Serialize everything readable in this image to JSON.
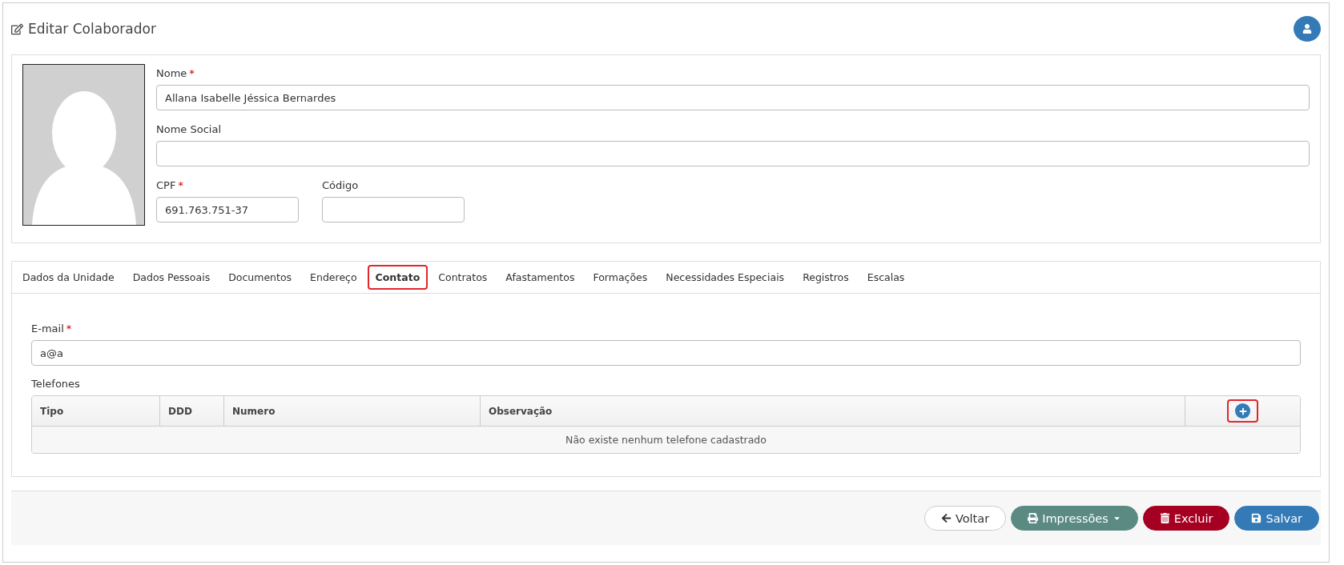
{
  "page_title": "Editar Colaborador",
  "profile": {
    "fields": [
      {
        "label": "Nome",
        "required_mark": "*",
        "value": "Allana Isabelle Jéssica Bernardes",
        "kind": "wide"
      },
      {
        "label": "Nome Social",
        "kind": "wide"
      },
      {
        "label": "CPF",
        "required_mark": "*",
        "value": "691.763.751-37",
        "kind": "narrow"
      },
      {
        "label": "Código",
        "kind": "narrow"
      }
    ]
  },
  "tabs": [
    {
      "label": "Dados da Unidade",
      "selected": false,
      "highlighted": false
    },
    {
      "label": "Dados Pessoais",
      "selected": false,
      "highlighted": false
    },
    {
      "label": "Documentos",
      "selected": false,
      "highlighted": false
    },
    {
      "label": "Endereço",
      "selected": false,
      "highlighted": false
    },
    {
      "label": "Contato",
      "selected": true,
      "highlighted": true
    },
    {
      "label": "Contratos",
      "selected": false,
      "highlighted": false
    },
    {
      "label": "Afastamentos",
      "selected": false,
      "highlighted": false
    },
    {
      "label": "Formações",
      "selected": false,
      "highlighted": false
    },
    {
      "label": "Necessidades Especiais",
      "selected": false,
      "highlighted": false
    },
    {
      "label": "Registros",
      "selected": false,
      "highlighted": false
    },
    {
      "label": "Escalas",
      "selected": false,
      "highlighted": false
    }
  ],
  "email": {
    "label": "E-mail",
    "required_mark": "*",
    "value": "a@a"
  },
  "phones": {
    "label": "Telefones",
    "columns": [
      "Tipo",
      "DDD",
      "Numero",
      "Observação"
    ],
    "add_highlighted": true,
    "empty_message": "Não existe nenhum telefone cadastrado"
  },
  "buttons": [
    {
      "kind": "back",
      "label": "Voltar"
    },
    {
      "kind": "print",
      "label": "Impressões"
    },
    {
      "kind": "delete",
      "label": "Excluir"
    },
    {
      "kind": "save",
      "label": "Salvar"
    }
  ]
}
